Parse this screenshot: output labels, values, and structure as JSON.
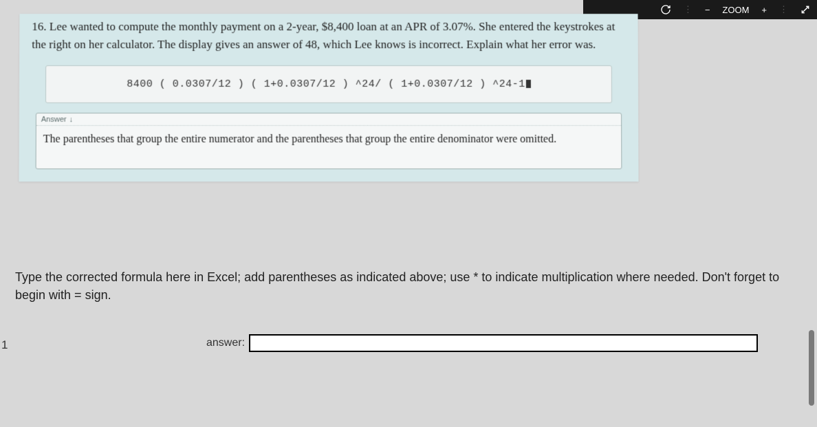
{
  "toolbar": {
    "minus": "−",
    "zoom_label": "ZOOM",
    "plus": "+"
  },
  "question": {
    "number_text": "16. Lee wanted to compute the monthly payment on a 2-year, $8,400 loan at an APR of 3.07%. She entered the keystrokes at the right on her calculator. The display gives an answer of 48, which Lee knows is incorrect. Explain what her error was.",
    "formula": "8400 ( 0.0307/12 ) ( 1+0.0307/12 ) ^24/ ( 1+0.0307/12 ) ^24-1",
    "answer_header": "Answer",
    "answer_body": "The parentheses that group the entire numerator and the parentheses that group the entire denominator were omitted."
  },
  "instruction_text": "Type the corrected formula here in Excel; add parentheses as indicated above; use * to indicate multiplication where needed. Don't forget to begin with = sign.",
  "row_number": "1",
  "input": {
    "label": "answer:",
    "value": ""
  }
}
